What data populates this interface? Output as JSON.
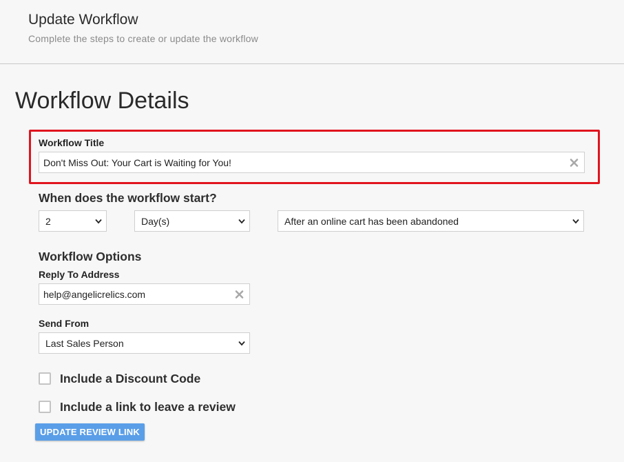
{
  "header": {
    "title": "Update Workflow",
    "subtitle": "Complete the steps to create or update the workflow"
  },
  "section": {
    "title": "Workflow Details"
  },
  "workflow_title": {
    "label": "Workflow Title",
    "value": "Don't Miss Out: Your Cart is Waiting for You!",
    "clear_icon": "close-icon"
  },
  "start": {
    "heading": "When does the workflow start?",
    "amount": "2",
    "unit": "Day(s)",
    "trigger": "After an online cart has been abandoned"
  },
  "options": {
    "heading": "Workflow Options",
    "reply_to_label": "Reply To Address",
    "reply_to_value": "help@angelicrelics.com",
    "send_from_label": "Send From",
    "send_from_value": "Last Sales Person"
  },
  "checkboxes": {
    "discount_label": "Include a Discount Code",
    "discount_checked": false,
    "review_label": "Include a link to leave a review",
    "review_checked": false
  },
  "buttons": {
    "update_review_link": "UPDATE REVIEW LINK"
  },
  "colors": {
    "highlight_border": "#e0141e",
    "primary_button": "#5a9ee8",
    "background": "#f7f7f7"
  }
}
